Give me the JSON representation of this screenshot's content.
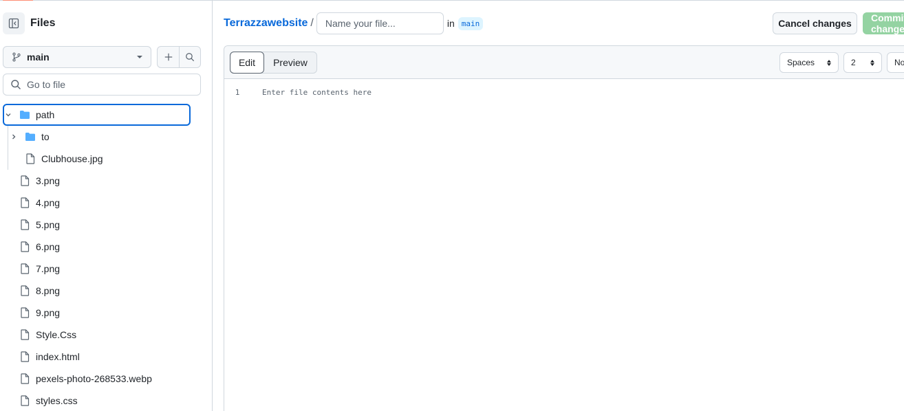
{
  "sidebar": {
    "title": "Files",
    "branch": "main",
    "goto_placeholder": "Go to file",
    "tree": [
      {
        "name": "path",
        "type": "folder",
        "depth": 0,
        "expanded": true,
        "selected": true
      },
      {
        "name": "to",
        "type": "folder",
        "depth": 1,
        "expanded": false
      },
      {
        "name": "Clubhouse.jpg",
        "type": "file",
        "depth": 1
      },
      {
        "name": "3.png",
        "type": "file",
        "depth": 0
      },
      {
        "name": "4.png",
        "type": "file",
        "depth": 0
      },
      {
        "name": "5.png",
        "type": "file",
        "depth": 0
      },
      {
        "name": "6.png",
        "type": "file",
        "depth": 0
      },
      {
        "name": "7.png",
        "type": "file",
        "depth": 0
      },
      {
        "name": "8.png",
        "type": "file",
        "depth": 0
      },
      {
        "name": "9.png",
        "type": "file",
        "depth": 0
      },
      {
        "name": "Style.Css",
        "type": "file",
        "depth": 0
      },
      {
        "name": "index.html",
        "type": "file",
        "depth": 0
      },
      {
        "name": "pexels-photo-268533.webp",
        "type": "file",
        "depth": 0
      },
      {
        "name": "styles.css",
        "type": "file",
        "depth": 0
      }
    ]
  },
  "header": {
    "repo": "Terrazzawebsite",
    "separator": "/",
    "filename_placeholder": "Name your file...",
    "in_label": "in",
    "branch": "main",
    "cancel_label": "Cancel changes",
    "commit_label": "Commit changes..."
  },
  "editor": {
    "tabs": [
      "Edit",
      "Preview"
    ],
    "active_tab": "Edit",
    "indent_mode": "Spaces",
    "indent_size": "2",
    "wrap_mode": "No wrap",
    "line_number": "1",
    "content_placeholder": "Enter file contents here"
  },
  "colors": {
    "accent": "#0969da",
    "folder": "#54aeff",
    "commit_disabled": "#94d3a2",
    "border": "#d0d7de"
  }
}
